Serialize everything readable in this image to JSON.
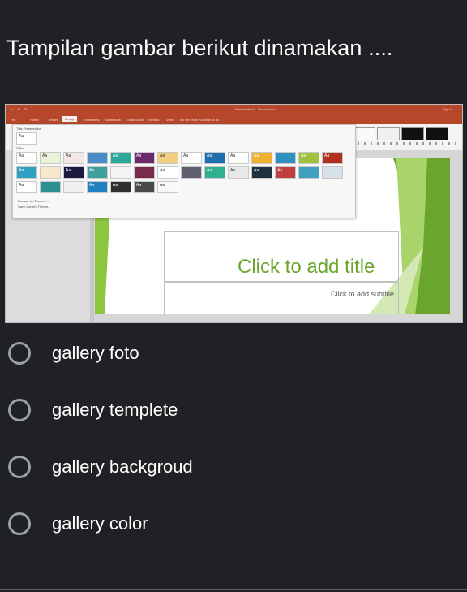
{
  "question": {
    "text": "Tampilan gambar berikut dinamakan ...."
  },
  "screenshot": {
    "app_title": "Presentation1 - PowerPoint",
    "sign_in": "Sign in",
    "tabs": [
      "File",
      "Home",
      "Insert",
      "Design",
      "Transitions",
      "Animations",
      "Slide Show",
      "Review",
      "View",
      "Tell me what you want to do"
    ],
    "active_tab": "Design",
    "gallery": {
      "this_presentation_label": "This Presentation",
      "office_label": "Office",
      "tile_text": "Aa",
      "browse_link": "Browse for Themes...",
      "save_link": "Save Current Theme..."
    },
    "slide": {
      "title_placeholder": "Click to add title",
      "subtitle_placeholder": "Click to add subtitle"
    },
    "colors": {
      "ribbon": "#b7472a",
      "accent_green": "#6aa62e"
    }
  },
  "options": [
    {
      "label": "gallery foto"
    },
    {
      "label": "gallery templete"
    },
    {
      "label": "gallery backgroud"
    },
    {
      "label": "gallery color"
    }
  ]
}
